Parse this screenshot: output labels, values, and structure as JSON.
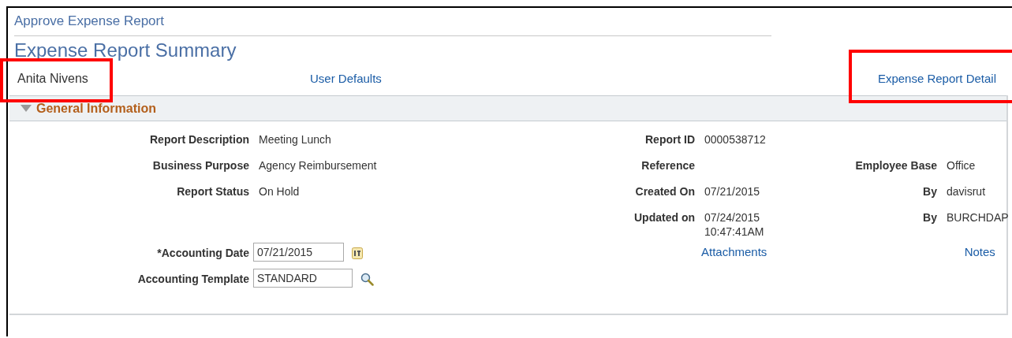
{
  "breadcrumb": "Approve Expense Report",
  "page_title": "Expense Report Summary",
  "header": {
    "employee_name": {
      "text": "Anita Nivens",
      "highlighted": true
    },
    "links": [
      {
        "label": "User Defaults",
        "highlighted": false
      },
      {
        "label": "Expense Report Detail",
        "highlighted": true
      }
    ]
  },
  "section": {
    "title": "General Information",
    "expanded": true,
    "rows": [
      {
        "left": {
          "kind": "text",
          "label": "Report Description",
          "value": "Meeting Lunch"
        },
        "middle": {
          "kind": "text",
          "label": "Report ID",
          "value": "0000538712"
        }
      },
      {
        "left": {
          "kind": "text",
          "label": "Business Purpose",
          "value": "Agency Reimbursement"
        },
        "middle": {
          "kind": "text",
          "label": "Reference"
        },
        "right": {
          "kind": "text",
          "label": "Employee Base",
          "value": "Office"
        }
      },
      {
        "left": {
          "kind": "text",
          "label": "Report Status",
          "value": "On Hold"
        },
        "middle": {
          "kind": "text",
          "label": "Created On",
          "value": "07/21/2015"
        },
        "right": {
          "kind": "text",
          "label": "By",
          "value": "davisrut"
        }
      },
      {
        "middle": {
          "kind": "text",
          "label": "Updated on",
          "value": "07/24/2015",
          "value_line_2": "10:47:41AM"
        },
        "right": {
          "kind": "text",
          "label": "By",
          "value": "BURCHDAP"
        }
      },
      {
        "left": {
          "kind": "date",
          "label": "*Accounting Date",
          "value": "07/21/2015"
        },
        "middle": {
          "kind": "link",
          "label": "Attachments"
        },
        "right": {
          "kind": "link",
          "label": "Notes"
        }
      },
      {
        "left": {
          "kind": "lookup",
          "label": "Accounting Template",
          "value": "STANDARD"
        }
      }
    ]
  }
}
